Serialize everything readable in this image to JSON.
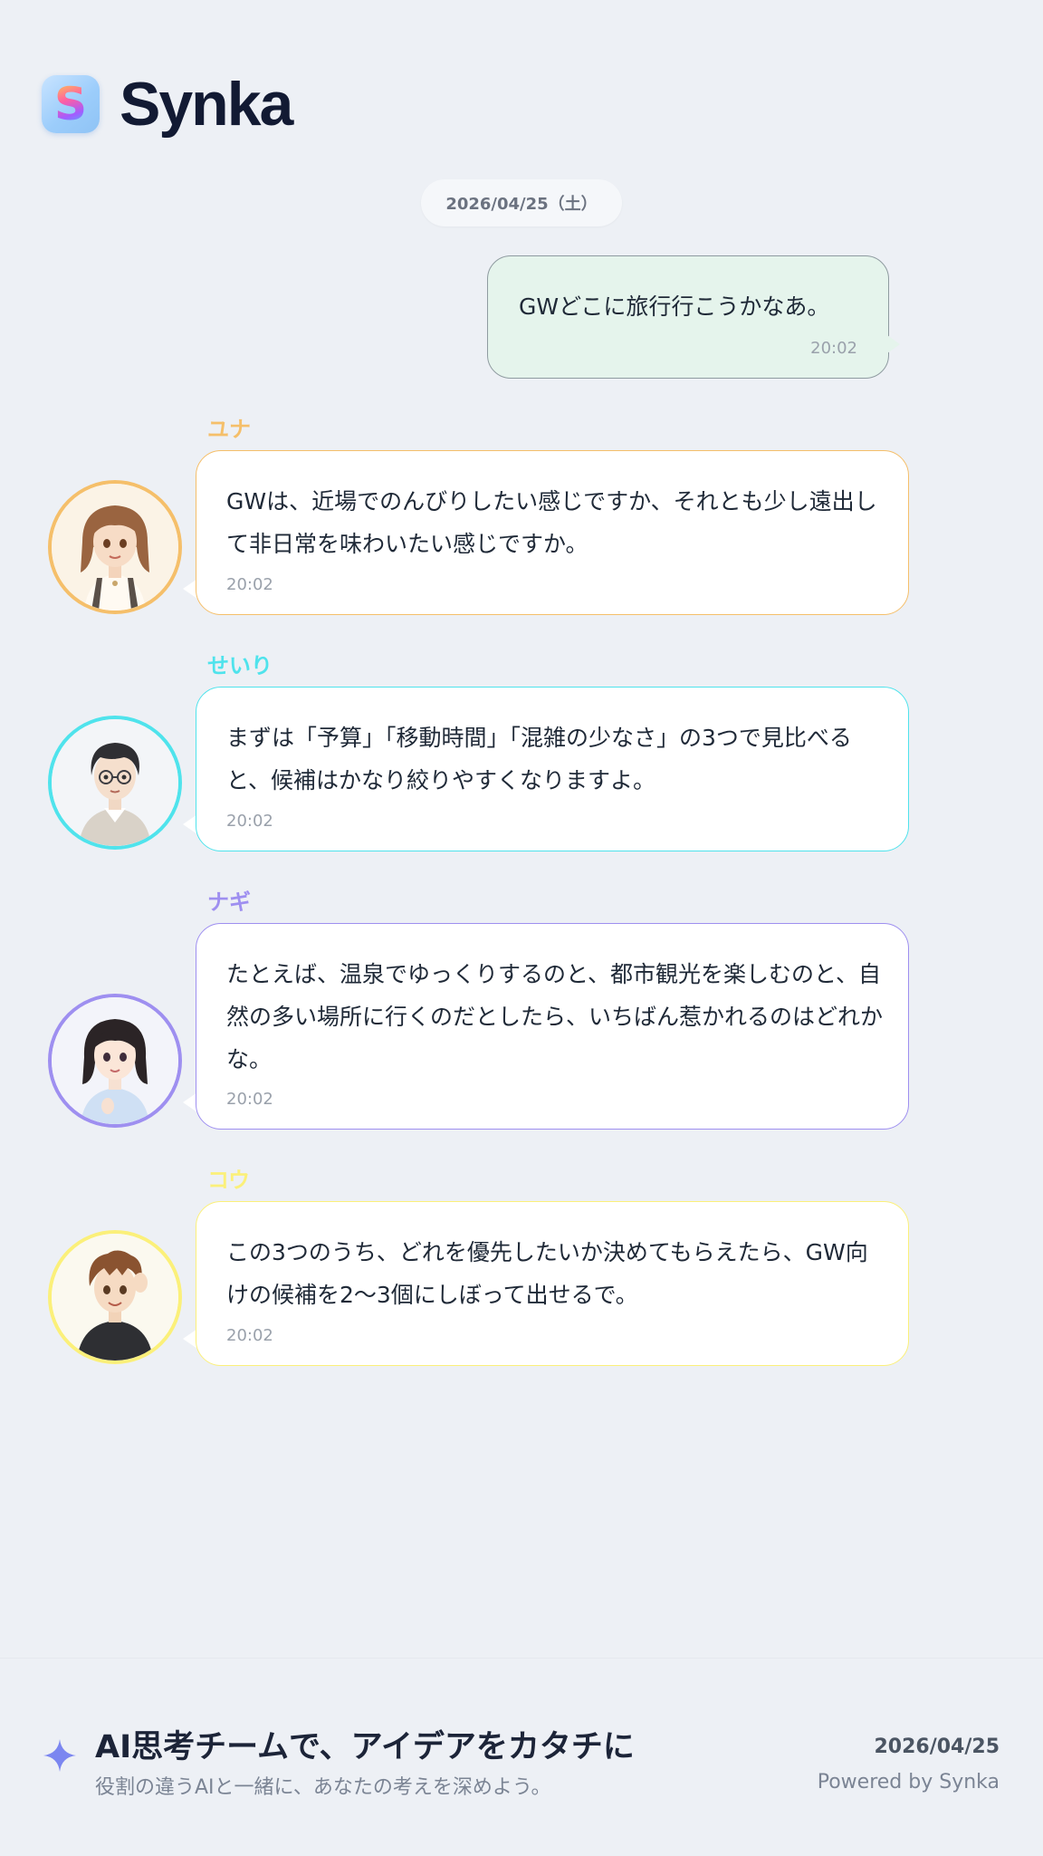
{
  "app": {
    "logo_letter": "S",
    "title": "Synka"
  },
  "date_separator": "2026/04/25（土）",
  "user_message": {
    "text": "GWどこに旅行行こうかなあ。",
    "time": "20:02"
  },
  "messages": [
    {
      "name": "ユナ",
      "color": "#f5bf6a",
      "text": "GWは、近場でのんびりしたい感じですか、それとも少し遠出して非日常を味わいたい感じですか。",
      "time": "20:02"
    },
    {
      "name": "せいり",
      "color": "#4fe3ec",
      "text": "まずは「予算」「移動時間」「混雑の少なさ」の3つで見比べると、候補はかなり絞りやすくなりますよ。",
      "time": "20:02"
    },
    {
      "name": "ナギ",
      "color": "#9e8ff0",
      "text": "たとえば、温泉でゆっくりするのと、都市観光を楽しむのと、自然の多い場所に行くのだとしたら、いちばん惹かれるのはどれかな。",
      "time": "20:02"
    },
    {
      "name": "コウ",
      "color": "#fbf07a",
      "text": "この3つのうち、どれを優先したいか決めてもらえたら、GW向けの候補を2〜3個にしぼって出せるで。",
      "time": "20:02"
    }
  ],
  "footer": {
    "headline": "AI思考チームで、アイデアをカタチに",
    "subtitle": "役割の違うAIと一緒に、あなたの考えを深めよう。",
    "date": "2026/04/25",
    "powered_by": "Powered by Synka"
  }
}
